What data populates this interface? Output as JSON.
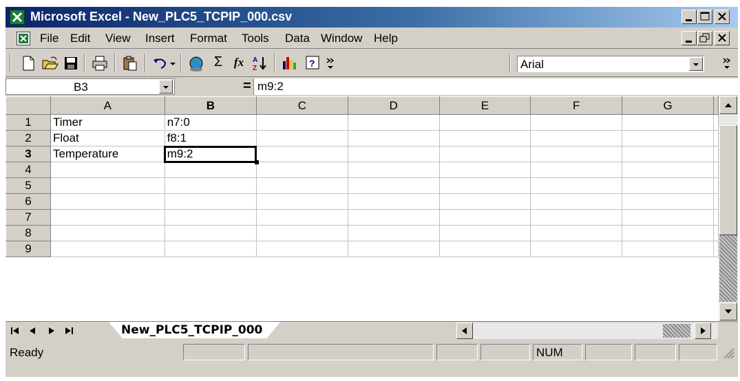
{
  "window": {
    "title": "Microsoft Excel - New_PLC5_TCPIP_000.csv"
  },
  "menu": {
    "items": [
      "File",
      "Edit",
      "View",
      "Insert",
      "Format",
      "Tools",
      "Data",
      "Window",
      "Help"
    ]
  },
  "toolbar": {
    "icons": [
      "new-icon",
      "open-icon",
      "save-icon",
      "print-icon",
      "paste-icon",
      "undo-icon",
      "web-icon",
      "autosum-icon",
      "function-icon",
      "sort-ascending-icon",
      "chart-wizard-icon",
      "help-icon",
      "more-buttons-icon"
    ],
    "autosum_glyph": "Σ",
    "function_glyph": "fx",
    "font": "Arial"
  },
  "formula_bar": {
    "name_box": "B3",
    "equals": "=",
    "content": "m9:2"
  },
  "sheet": {
    "columns": [
      "A",
      "B",
      "C",
      "D",
      "E",
      "F",
      "G"
    ],
    "active_column": "B",
    "active_row": "3",
    "rows": [
      {
        "num": "1",
        "cells": [
          "Timer",
          "n7:0",
          "",
          "",
          "",
          "",
          ""
        ]
      },
      {
        "num": "2",
        "cells": [
          "Float",
          "f8:1",
          "",
          "",
          "",
          "",
          ""
        ]
      },
      {
        "num": "3",
        "cells": [
          "Temperature",
          "m9:2",
          "",
          "",
          "",
          "",
          ""
        ]
      },
      {
        "num": "4",
        "cells": [
          "",
          "",
          "",
          "",
          "",
          "",
          ""
        ]
      },
      {
        "num": "5",
        "cells": [
          "",
          "",
          "",
          "",
          "",
          "",
          ""
        ]
      },
      {
        "num": "6",
        "cells": [
          "",
          "",
          "",
          "",
          "",
          "",
          ""
        ]
      },
      {
        "num": "7",
        "cells": [
          "",
          "",
          "",
          "",
          "",
          "",
          ""
        ]
      },
      {
        "num": "8",
        "cells": [
          "",
          "",
          "",
          "",
          "",
          "",
          ""
        ]
      },
      {
        "num": "9",
        "cells": [
          "",
          "",
          "",
          "",
          "",
          "",
          ""
        ]
      }
    ]
  },
  "sheet_tab": "New_PLC5_TCPIP_000",
  "status": {
    "ready": "Ready",
    "num": "NUM"
  },
  "colors": {
    "titlebar_start": "#0a246a",
    "titlebar_end": "#a6caf0",
    "chrome": "#d4d0c8",
    "grid_line": "#c0c0c0"
  }
}
